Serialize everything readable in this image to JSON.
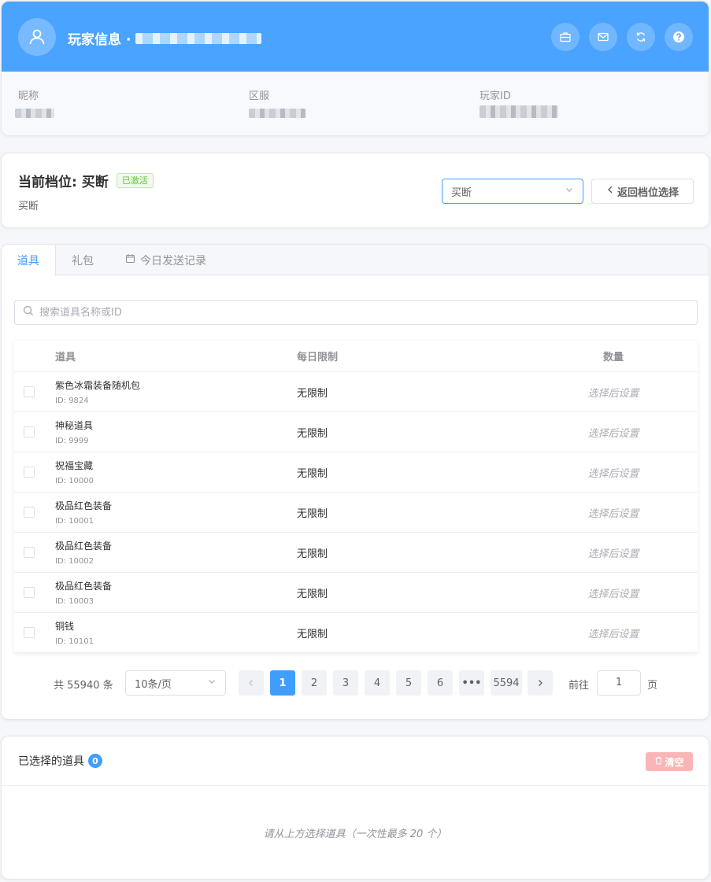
{
  "player": {
    "title_prefix": "玩家信息 ·",
    "labels": {
      "nickname": "昵称",
      "server": "区服",
      "player_id": "玩家ID"
    },
    "header_icons": [
      "briefcase-icon",
      "mail-icon",
      "refresh-icon",
      "help-icon"
    ]
  },
  "tier": {
    "title": "当前档位: 买断",
    "status": "已激活",
    "subtitle": "买断",
    "select_value": "买断",
    "back_button": "返回档位选择"
  },
  "tabs": [
    {
      "label": "道具",
      "active": true
    },
    {
      "label": "礼包",
      "active": false
    },
    {
      "label": "今日发送记录",
      "active": false,
      "icon": "calendar-icon"
    }
  ],
  "search": {
    "placeholder": "搜索道具名称或ID",
    "value": ""
  },
  "table": {
    "headers": {
      "item": "道具",
      "limit": "每日限制",
      "qty": "数量"
    },
    "rows": [
      {
        "name": "紫色冰霜装备随机包",
        "id": "ID: 9824",
        "limit": "无限制",
        "qty": "选择后设置"
      },
      {
        "name": "神秘道具",
        "id": "ID: 9999",
        "limit": "无限制",
        "qty": "选择后设置"
      },
      {
        "name": "祝福宝藏",
        "id": "ID: 10000",
        "limit": "无限制",
        "qty": "选择后设置"
      },
      {
        "name": "极品红色装备",
        "id": "ID: 10001",
        "limit": "无限制",
        "qty": "选择后设置"
      },
      {
        "name": "极品红色装备",
        "id": "ID: 10002",
        "limit": "无限制",
        "qty": "选择后设置"
      },
      {
        "name": "极品红色装备",
        "id": "ID: 10003",
        "limit": "无限制",
        "qty": "选择后设置"
      },
      {
        "name": "铜钱",
        "id": "ID: 10101",
        "limit": "无限制",
        "qty": "选择后设置"
      }
    ]
  },
  "pagination": {
    "total": "共 55940 条",
    "page_size": "10条/页",
    "pages": [
      "1",
      "2",
      "3",
      "4",
      "5",
      "6",
      "•••",
      "5594"
    ],
    "current": "1",
    "goto_label": "前往",
    "goto_value": "1",
    "goto_suffix": "页"
  },
  "selected": {
    "title": "已选择的道具",
    "count": "0",
    "clear_button": "清空",
    "empty_text": "请从上方选择道具（一次性最多 20 个）"
  },
  "colors": {
    "primary": "#409eff",
    "header": "#4aa3ff",
    "success": "#67c23a",
    "danger_light": "#fab6b6"
  }
}
